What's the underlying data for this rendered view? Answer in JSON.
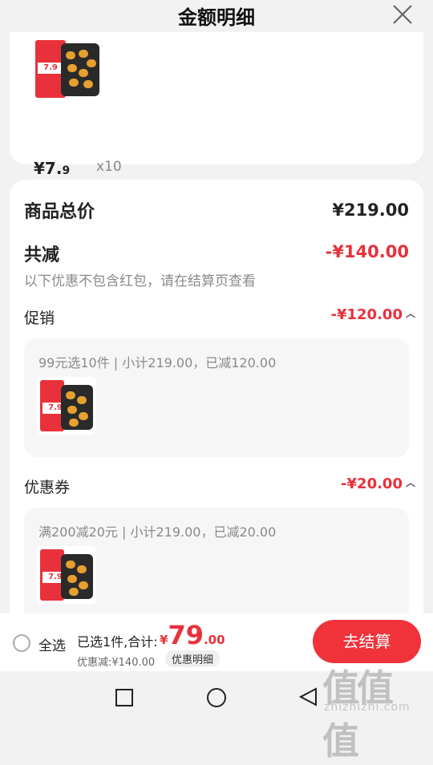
{
  "header": {
    "title": "金额明细",
    "close_icon": "close-icon"
  },
  "product": {
    "thumb_price": "7.9",
    "price_int": "¥7.",
    "price_dec": "9",
    "quantity": "x10"
  },
  "summary": {
    "total_label": "商品总价",
    "total_value": "¥219.00",
    "minus_label": "共减",
    "minus_value": "-¥140.00",
    "note": "以下优惠不包含红包，请在结算页查看"
  },
  "promotion": {
    "title": "促销",
    "value": "-¥120.00",
    "detail": "99元选10件 | 小计219.00，已减120.00",
    "thumb_price": "7.9"
  },
  "coupon": {
    "title": "优惠券",
    "value": "-¥20.00",
    "detail": "满200减20元 | 小计219.00，已减20.00",
    "thumb_price": "7.9"
  },
  "bottom_bar": {
    "select_all": "全选",
    "selected_text": "已选1件,合计:",
    "currency": "¥",
    "total_int": "79",
    "total_dec": ".00",
    "discount_text": "优惠减:¥140.00",
    "detail_button": "优惠明细",
    "checkout_button": "去结算"
  },
  "watermark": {
    "glyphs": "值值值",
    "url": "zhizhizhi.com"
  },
  "colors": {
    "accent": "#e8313a",
    "checkout": "#f0323a",
    "background": "#f2f2f2"
  }
}
